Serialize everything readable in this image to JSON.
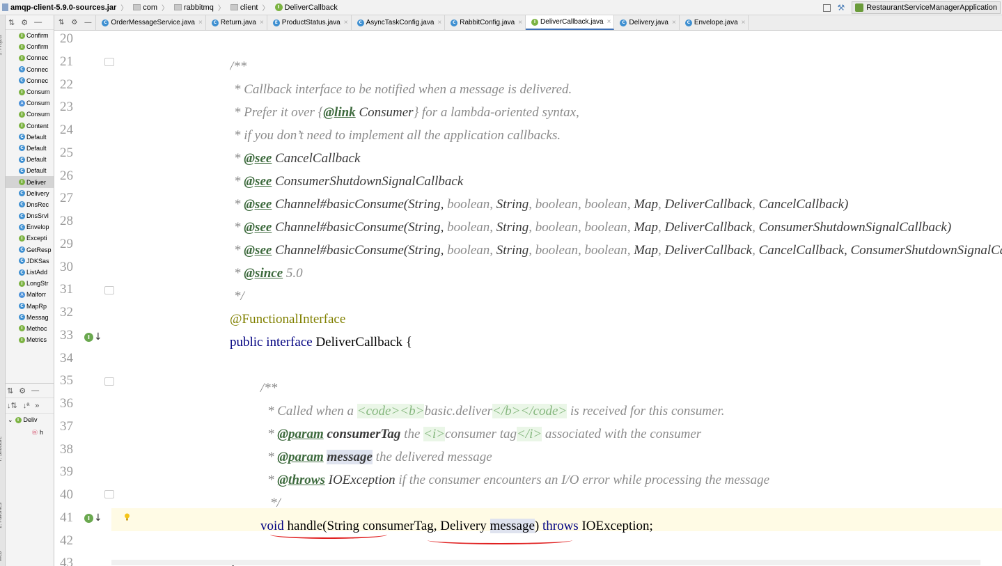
{
  "breadcrumb": [
    {
      "label": "amqp-client-5.9.0-sources.jar",
      "icon": "jar-icon"
    },
    {
      "label": "com",
      "icon": "folder-icon"
    },
    {
      "label": "rabbitmq",
      "icon": "folder-icon"
    },
    {
      "label": "client",
      "icon": "folder-icon"
    },
    {
      "label": "DeliverCallback",
      "icon": "interface-icon"
    }
  ],
  "run_config": {
    "label": "RestaurantServiceManagerApplication"
  },
  "tool_stripe": {
    "project": "1: Project",
    "structure": "7: Structure",
    "favorites": "2: Favorites",
    "web": "Web"
  },
  "tabs": [
    {
      "label": "OrderMessageService.java",
      "kind": "class"
    },
    {
      "label": "Return.java",
      "kind": "class"
    },
    {
      "label": "ProductStatus.java",
      "kind": "enum"
    },
    {
      "label": "AsyncTaskConfig.java",
      "kind": "class"
    },
    {
      "label": "RabbitConfig.java",
      "kind": "class"
    },
    {
      "label": "DeliverCallback.java",
      "kind": "interface",
      "active": true
    },
    {
      "label": "Delivery.java",
      "kind": "class"
    },
    {
      "label": "Envelope.java",
      "kind": "class"
    }
  ],
  "project_tree": [
    {
      "label": "Confirm",
      "kind": "interface"
    },
    {
      "label": "Confirm",
      "kind": "interface"
    },
    {
      "label": "Connec",
      "kind": "interface"
    },
    {
      "label": "Connec",
      "kind": "class"
    },
    {
      "label": "Connec",
      "kind": "class"
    },
    {
      "label": "Consum",
      "kind": "interface"
    },
    {
      "label": "Consum",
      "kind": "abstract"
    },
    {
      "label": "Consum",
      "kind": "interface"
    },
    {
      "label": "Content",
      "kind": "interface"
    },
    {
      "label": "Default",
      "kind": "class"
    },
    {
      "label": "Default",
      "kind": "class"
    },
    {
      "label": "Default",
      "kind": "class"
    },
    {
      "label": "Default",
      "kind": "class"
    },
    {
      "label": "Deliver",
      "kind": "interface",
      "selected": true
    },
    {
      "label": "Delivery",
      "kind": "class"
    },
    {
      "label": "DnsRec",
      "kind": "class"
    },
    {
      "label": "DnsSrvI",
      "kind": "class"
    },
    {
      "label": "Envelop",
      "kind": "class"
    },
    {
      "label": "Excepti",
      "kind": "interface"
    },
    {
      "label": "GetResp",
      "kind": "class"
    },
    {
      "label": "JDKSas",
      "kind": "class"
    },
    {
      "label": "ListAdd",
      "kind": "class"
    },
    {
      "label": "LongStr",
      "kind": "interface"
    },
    {
      "label": "Malforr",
      "kind": "abstract"
    },
    {
      "label": "MapRp",
      "kind": "class"
    },
    {
      "label": "Messag",
      "kind": "class"
    },
    {
      "label": "Methoc",
      "kind": "interface"
    },
    {
      "label": "Metrics",
      "kind": "interface"
    }
  ],
  "structure": {
    "interface": "Deliv",
    "method": "h"
  },
  "gutter": {
    "lines": [
      "20",
      "21",
      "22",
      "23",
      "24",
      "25",
      "26",
      "27",
      "28",
      "29",
      "30",
      "31",
      "32",
      "33",
      "34",
      "35",
      "36",
      "37",
      "38",
      "39",
      "40",
      "41",
      "42",
      "43"
    ]
  },
  "code": {
    "l21": "/**",
    "l22": "* Callback interface to be notified when a message is delivered.",
    "l23a": "* Prefer it over {",
    "l23b": "@link",
    "l23c": "Consumer",
    "l23d": "} for a lambda-oriented syntax,",
    "l24": "* if you don’t need to implement all the application callbacks.",
    "see": "@see",
    "star": "*",
    "l25": "CancelCallback",
    "l26": "ConsumerShutdownSignalCallback",
    "consume": "Channel#basicConsume",
    "args27a": "(String, ",
    "args": [
      "boolean",
      "String",
      "boolean",
      "boolean",
      "Map",
      "DeliverCallback"
    ],
    "l27end": "CancelCallback)",
    "l28end": "ConsumerShutdownSignalCallback)",
    "l29end": "CancelCallback, ConsumerShutdownSignalCallback)",
    "since": "@since",
    "since_v": "5.0",
    "l31": "*/",
    "l32": "@FunctionalInterface",
    "l33a": "public interface",
    "l33b": "DeliverCallback {",
    "l35": "/**",
    "l36a": "* Called when a ",
    "l36b": "<code><b>",
    "l36c": "basic.deliver",
    "l36d": "</b></code>",
    "l36e": " is received for this consumer.",
    "param": "@param",
    "l37p": "consumerTag",
    "l37a": " the ",
    "l37b": "<i>",
    "l37c": "consumer tag",
    "l37d": "</i>",
    "l37e": " associated with the consumer",
    "l38p": "message",
    "l38e": " the delivered message",
    "throws": "@throws",
    "l39p": "IOException",
    "l39e": " if the consumer encounters an I/O error while processing the message",
    "l40": "*/",
    "l41a": "void",
    "l41b": " handle(String consumerTag, Delivery ",
    "l41c": "message",
    "l41d": ") ",
    "l41e": "throws",
    "l41f": " IOException;",
    "l43": "}"
  }
}
